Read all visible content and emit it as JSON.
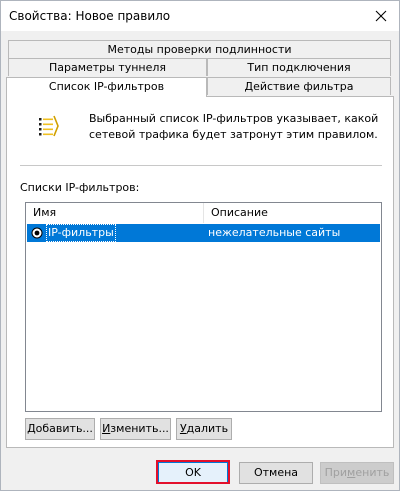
{
  "window": {
    "title": "Свойства: Новое правило"
  },
  "tabs": [
    {
      "label": "Методы проверки подлинности"
    },
    {
      "label": "Параметры туннеля"
    },
    {
      "label": "Тип подключения"
    },
    {
      "label": "Список IP-фильтров"
    },
    {
      "label": "Действие фильтра"
    }
  ],
  "panel": {
    "info_text": "Выбранный список IP-фильтров указывает, какой сетевой трафика будет затронут этим правилом.",
    "list_label": "Списки IP-фильтров:",
    "columns": [
      {
        "label": "Имя"
      },
      {
        "label": "Описание"
      }
    ],
    "rows": [
      {
        "name": "IP-фильтры",
        "description": "нежелательные сайты",
        "selected": true
      }
    ],
    "buttons": {
      "add": {
        "ul": "Д",
        "rest": "обавить..."
      },
      "edit": {
        "ul": "И",
        "rest": "зменить..."
      },
      "remove": {
        "ul": "У",
        "rest": "далить"
      }
    }
  },
  "footer": {
    "ok": "OK",
    "cancel": "Отмена",
    "apply": {
      "pre": "При",
      "ul": "м",
      "rest": "енить"
    }
  },
  "colors": {
    "selection": "#0078d7",
    "highlight": "#e3102b"
  },
  "icons": [
    "close-icon",
    "filter-list-icon",
    "radio-selected-icon"
  ]
}
